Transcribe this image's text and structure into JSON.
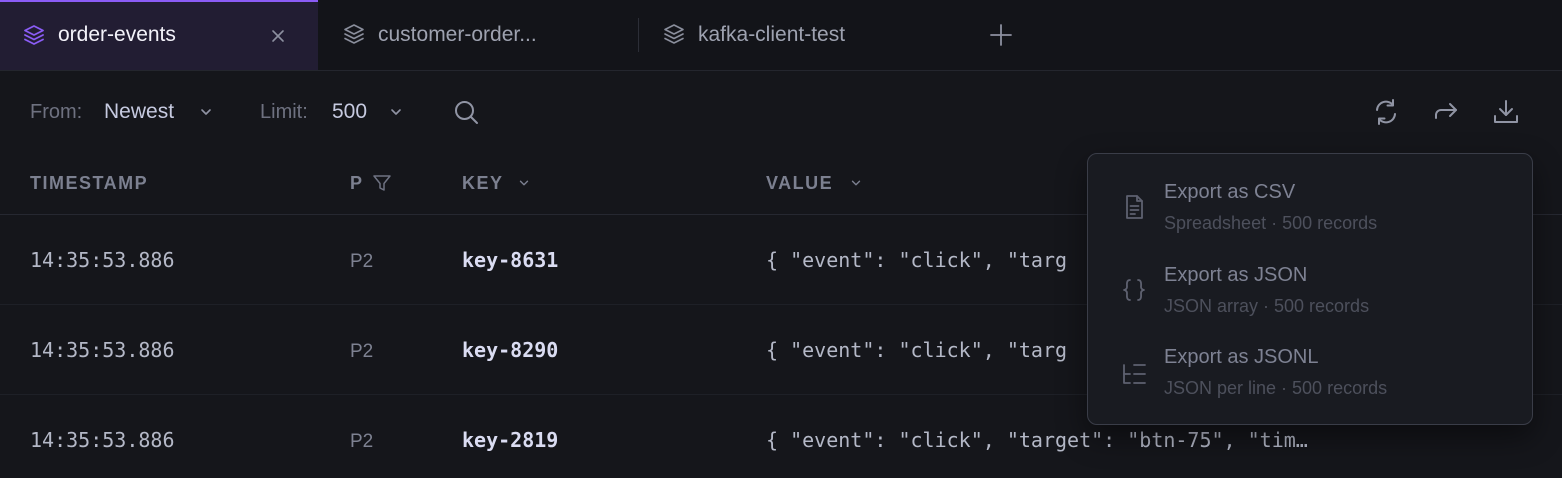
{
  "tabs": [
    {
      "label": "order-events",
      "active": true
    },
    {
      "label": "customer-order...",
      "active": false
    },
    {
      "label": "kafka-client-test",
      "active": false
    }
  ],
  "toolbar": {
    "from_label": "From:",
    "from_value": "Newest",
    "limit_label": "Limit:",
    "limit_value": "500"
  },
  "table": {
    "columns": [
      "TIMESTAMP",
      "P",
      "KEY",
      "VALUE"
    ],
    "rows": [
      {
        "timestamp": "14:35:53.886",
        "partition": "P2",
        "key": "key-8631",
        "value": "{ \"event\": \"click\", \"targ"
      },
      {
        "timestamp": "14:35:53.886",
        "partition": "P2",
        "key": "key-8290",
        "value": "{ \"event\": \"click\", \"targ"
      },
      {
        "timestamp": "14:35:53.886",
        "partition": "P2",
        "key": "key-2819",
        "value": "{ \"event\": \"click\", \"target\": \"btn-75\", \"tim…"
      }
    ]
  },
  "export_menu": {
    "items": [
      {
        "title": "Export as CSV",
        "subtitle": "Spreadsheet · 500 records",
        "icon": "file-text-icon"
      },
      {
        "title": "Export as JSON",
        "subtitle": "JSON array · 500 records",
        "icon": "braces-icon"
      },
      {
        "title": "Export as JSONL",
        "subtitle": "JSON per line · 500 records",
        "icon": "list-tree-icon"
      }
    ]
  },
  "colors": {
    "accent": "#8b5cf6",
    "background": "#15161b",
    "active_tab": "#221d33"
  }
}
